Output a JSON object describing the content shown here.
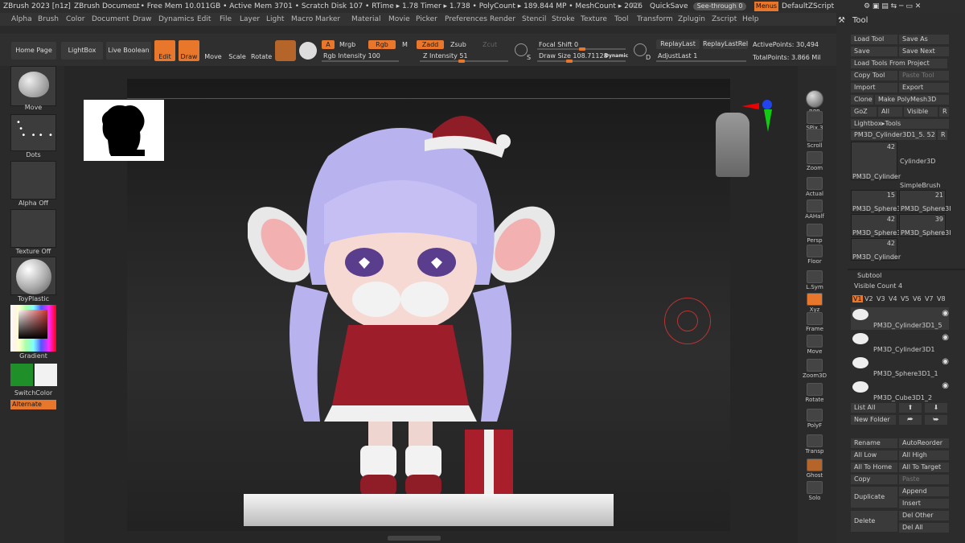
{
  "titlebar": {
    "app": "ZBrush 2023 [n1z]",
    "doc": "ZBrush Document",
    "stats": "..  • Free Mem 10.011GB • Active Mem 3701 • Scratch Disk 107 • RTime ▸ 1.78 Timer ▸ 1.738 • PolyCount ▸ 189.844 MP • MeshCount ▸ 2026",
    "ac": "AC",
    "quicksave": "QuickSave",
    "seethrough": "See-through  0",
    "menus": "Menus",
    "zscript": "DefaultZScript"
  },
  "menubar": [
    "Alpha",
    "Brush",
    "Color",
    "Document",
    "Draw",
    "Dynamics",
    "Edit",
    "File",
    "Layer",
    "Light",
    "Macro",
    "Marker",
    "Material",
    "Movie",
    "Picker",
    "Preferences",
    "Render",
    "Stencil",
    "Stroke",
    "Texture",
    "Tool",
    "Transform",
    "Zplugin",
    "Zscript",
    "Help"
  ],
  "topshelf": {
    "home": "Home Page",
    "lightbox": "LightBox",
    "liveboolean": "Live Boolean",
    "edit": "Edit",
    "draw": "Draw",
    "move": "Move",
    "scale": "Scale",
    "rotate": "Rotate",
    "a": "A",
    "mrgb": "Mrgb",
    "rgb": "Rgb",
    "m": "M",
    "zadd": "Zadd",
    "zsub": "Zsub",
    "zcut": "Zcut",
    "rgb_intensity": "Rgb Intensity 100",
    "z_intensity": "Z Intensity 51",
    "focal": "Focal Shift 0",
    "drawsize": "Draw Size 108.71128",
    "dynamic": "Dynamic",
    "replaylast": "ReplayLast",
    "replaylastrel": "ReplayLastRel",
    "adjustlast": "AdjustLast 1",
    "activepoints": "ActivePoints: 30,494",
    "totalpoints": "TotalPoints: 3.866 Mil",
    "s_key": "S",
    "d_key": "D"
  },
  "leftshelf": {
    "move": "Move",
    "dots": "Dots",
    "alpha": "Alpha Off",
    "texture": "Texture Off",
    "material": "ToyPlastic",
    "gradient": "Gradient",
    "switch": "SwitchColor",
    "alternate": "Alternate"
  },
  "rightshelf": [
    "BPR",
    "SPix 3",
    "Scroll",
    "Zoom",
    "Actual",
    "AAHalf",
    "Persp",
    "Floor",
    "L.Sym",
    "Xyz",
    "Frame",
    "Move",
    "Zoom3D",
    "Rotate",
    "PolyF",
    "Transp",
    "Ghost",
    "Solo"
  ],
  "toolpanel": {
    "title": "Tool",
    "buttons": [
      [
        "Load Tool",
        "Save As"
      ],
      [
        "Save",
        "Save Next"
      ],
      [
        "Load Tools From Project",
        ""
      ],
      [
        "Copy Tool",
        "Paste Tool"
      ],
      [
        "Import",
        "Export"
      ],
      [
        "Clone",
        "Make PolyMesh3D"
      ],
      [
        "GoZ",
        "All",
        "Visible",
        "R"
      ]
    ],
    "lightbox": "Lightbox▸Tools",
    "current": "PM3D_Cylinder3D1_5. 52",
    "current_r": "R",
    "thumbs": [
      {
        "name": "PM3D_Cylinder",
        "count": "42"
      },
      {
        "name": "Cylinder3D",
        "count": ""
      },
      {
        "name": "SimpleBrush",
        "count": ""
      },
      {
        "name": "PM3D_Sphere3I",
        "count": "15"
      },
      {
        "name": "PM3D_Sphere3I",
        "count": "21"
      },
      {
        "name": "PM3D_Sphere3I",
        "count": "42"
      },
      {
        "name": "PM3D_Sphere3I",
        "count": "39"
      },
      {
        "name": "PM3D_Cylinder",
        "count": "42"
      }
    ],
    "subtool": "Subtool",
    "visiblecount": "Visible Count 4",
    "versions": [
      "V1",
      "V2",
      "V3",
      "V4",
      "V5",
      "V6",
      "V7",
      "V8"
    ],
    "subtools": [
      "PM3D_Cylinder3D1_5",
      "PM3D_Cylinder3D1",
      "PM3D_Sphere3D1_1",
      "PM3D_Cube3D1_2"
    ],
    "listall": "List All",
    "newfolder": "New Folder",
    "actions": [
      [
        "Rename",
        "AutoReorder"
      ],
      [
        "All Low",
        "All High"
      ],
      [
        "All To Home",
        "All To Target"
      ],
      [
        "Copy",
        "Paste"
      ]
    ],
    "duplicate": "Duplicate",
    "append": "Append",
    "insert": "Insert",
    "delete": "Delete",
    "delother": "Del Other",
    "delall": "Del All"
  },
  "colors": {
    "accent": "#e8772c",
    "primary_swatch": "#1f8f2a",
    "secondary_swatch": "#f2f2f2"
  }
}
